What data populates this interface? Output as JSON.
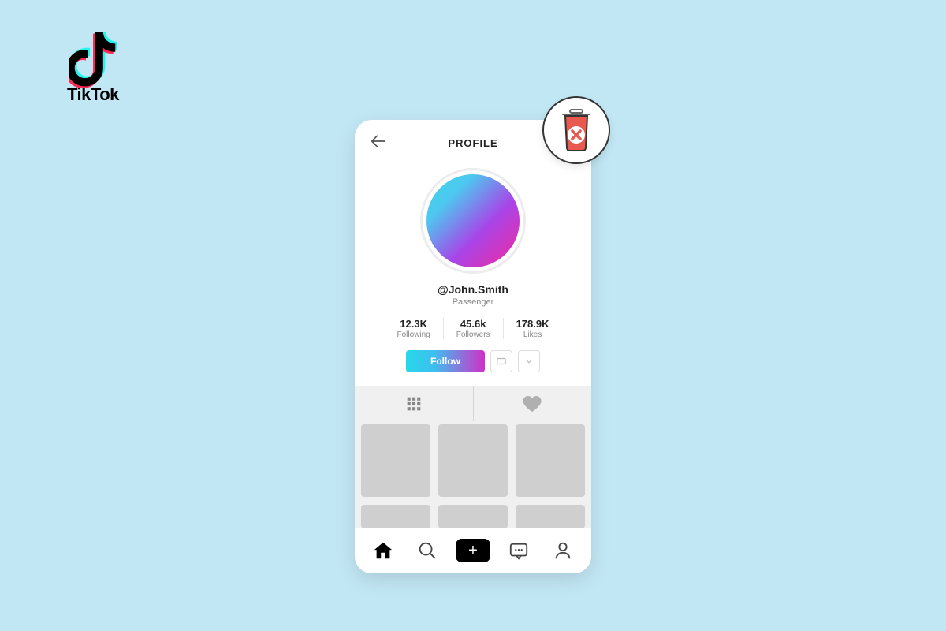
{
  "brand": {
    "name": "TikTok"
  },
  "header": {
    "title": "PROFILE"
  },
  "profile": {
    "username": "@John.Smith",
    "subtitle": "Passenger"
  },
  "stats": {
    "following": {
      "value": "12.3K",
      "label": "Following"
    },
    "followers": {
      "value": "45.6k",
      "label": "Followers"
    },
    "likes": {
      "value": "178.9K",
      "label": "Likes"
    }
  },
  "actions": {
    "follow_label": "Follow"
  },
  "tabs": {
    "grid": "grid",
    "likes": "likes"
  },
  "nav": {
    "home": "home",
    "search": "search",
    "create": "create",
    "inbox": "inbox",
    "profile": "profile"
  }
}
